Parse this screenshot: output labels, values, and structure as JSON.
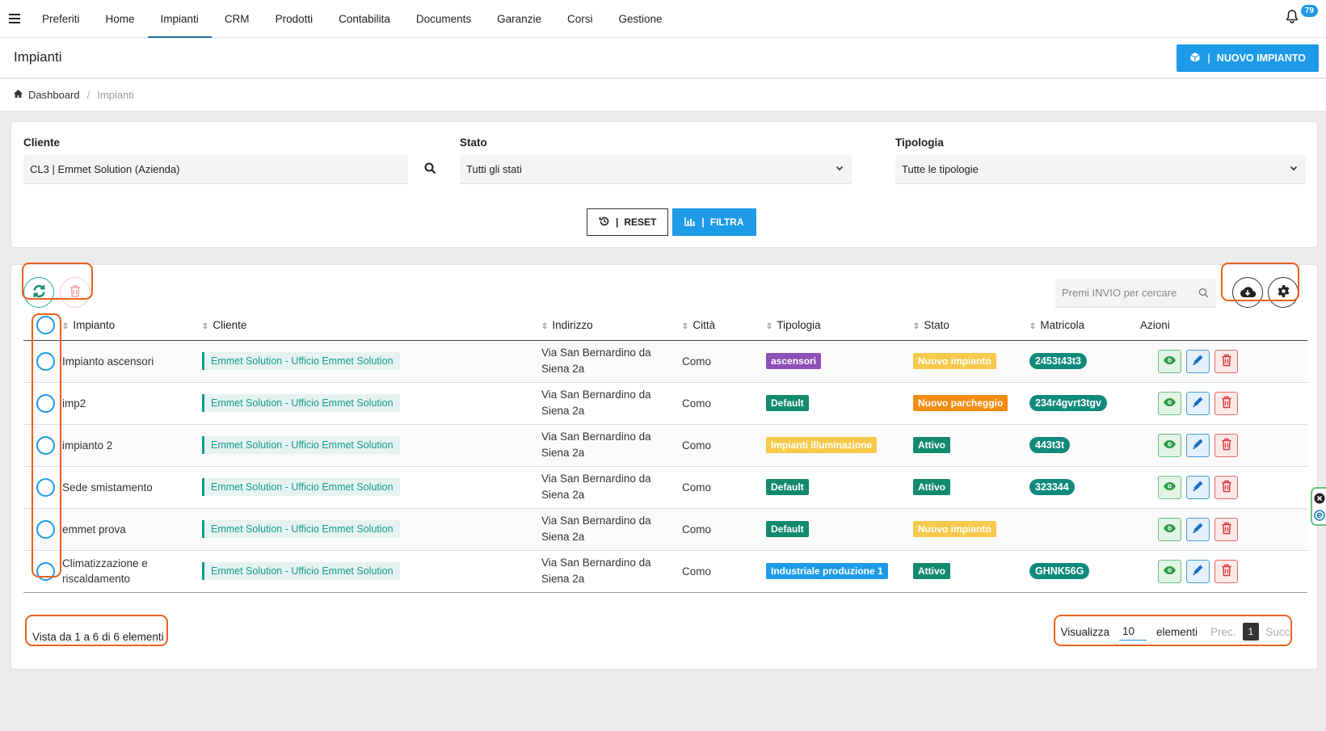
{
  "nav": {
    "items": [
      "Preferiti",
      "Home",
      "Impianti",
      "CRM",
      "Prodotti",
      "Contabilita",
      "Documents",
      "Garanzie",
      "Corsi",
      "Gestione"
    ],
    "active": "Impianti",
    "notifications": "79"
  },
  "page": {
    "title": "Impianti",
    "new_button": "NUOVO IMPIANTO"
  },
  "breadcrumb": {
    "home": "Dashboard",
    "current": "Impianti"
  },
  "filters": {
    "cliente_label": "Cliente",
    "cliente_value": "CL3 | Emmet Solution (Azienda)",
    "stato_label": "Stato",
    "stato_value": "Tutti gli stati",
    "tipologia_label": "Tipologia",
    "tipologia_value": "Tutte le tipologie",
    "reset": "RESET",
    "filtra": "FILTRA"
  },
  "table": {
    "search_placeholder": "Premi INVIO per cercare",
    "columns": [
      "Impianto",
      "Cliente",
      "Indirizzo",
      "Città",
      "Tipologia",
      "Stato",
      "Matricola",
      "Azioni"
    ],
    "rows": [
      {
        "impianto": "Impianto ascensori",
        "cliente": "Emmet Solution - Ufficio Emmet Solution",
        "indirizzo_1": "Via San Bernardino da",
        "indirizzo_2": "Siena 2a",
        "citta": "Como",
        "tipologia": "ascensori",
        "tipologia_color": "#8e4fb8",
        "stato": "Nuovo impianto",
        "stato_color": "#f7c94a",
        "matricola": "2453t43t3"
      },
      {
        "impianto": "imp2",
        "cliente": "Emmet Solution - Ufficio Emmet Solution",
        "indirizzo_1": "Via San Bernardino da",
        "indirizzo_2": "Siena 2a",
        "citta": "Como",
        "tipologia": "Default",
        "tipologia_color": "#138a6e",
        "stato": "Nuovo parcheggio",
        "stato_color": "#f28c12",
        "matricola": "234r4gvrt3tgv"
      },
      {
        "impianto": "impianto 2",
        "cliente": "Emmet Solution - Ufficio Emmet Solution",
        "indirizzo_1": "Via San Bernardino da",
        "indirizzo_2": "Siena 2a",
        "citta": "Como",
        "tipologia": "Impianti illuminazione",
        "tipologia_color": "#f7c94a",
        "stato": "Attivo",
        "stato_color": "#138a6e",
        "matricola": "443t3t"
      },
      {
        "impianto": "Sede smistamento",
        "cliente": "Emmet Solution - Ufficio Emmet Solution",
        "indirizzo_1": "Via San Bernardino da",
        "indirizzo_2": "Siena 2a",
        "citta": "Como",
        "tipologia": "Default",
        "tipologia_color": "#138a6e",
        "stato": "Attivo",
        "stato_color": "#138a6e",
        "matricola": "323344"
      },
      {
        "impianto": "emmet prova",
        "cliente": "Emmet Solution - Ufficio Emmet Solution",
        "indirizzo_1": "Via San Bernardino da",
        "indirizzo_2": "Siena 2a",
        "citta": "Como",
        "tipologia": "Default",
        "tipologia_color": "#138a6e",
        "stato": "Nuovo impianto",
        "stato_color": "#f7c94a",
        "matricola": ""
      },
      {
        "impianto": "Climatizzazione e riscaldamento",
        "cliente": "Emmet Solution - Ufficio Emmet Solution",
        "indirizzo_1": "Via San Bernardino da",
        "indirizzo_2": "Siena 2a",
        "citta": "Como",
        "tipologia": "Industriale produzione 1",
        "tipologia_color": "#1e9be8",
        "stato": "Attivo",
        "stato_color": "#138a6e",
        "matricola": "GHNK56G"
      }
    ]
  },
  "footer": {
    "info": "Vista da 1 a 6 di 6 elementi",
    "show_label": "Visualizza",
    "page_size": "10",
    "elements_label": "elementi",
    "prev": "Prec.",
    "current_page": "1",
    "next": "Succ."
  },
  "icons": {
    "menu": "hamburger-icon",
    "bell": "bell-icon",
    "new": "cube-icon",
    "home": "home-icon",
    "search": "search-icon",
    "reset": "history-icon",
    "filtra": "chart-bar-icon",
    "refresh": "refresh-icon",
    "trash": "trash-icon",
    "download": "cloud-download-icon",
    "settings": "gear-icon",
    "view": "eye-icon",
    "edit": "pencil-icon",
    "delete": "trash-icon"
  },
  "colors": {
    "accent": "#1e9be8",
    "highlight": "#e8621f",
    "teal": "#138a6e"
  }
}
